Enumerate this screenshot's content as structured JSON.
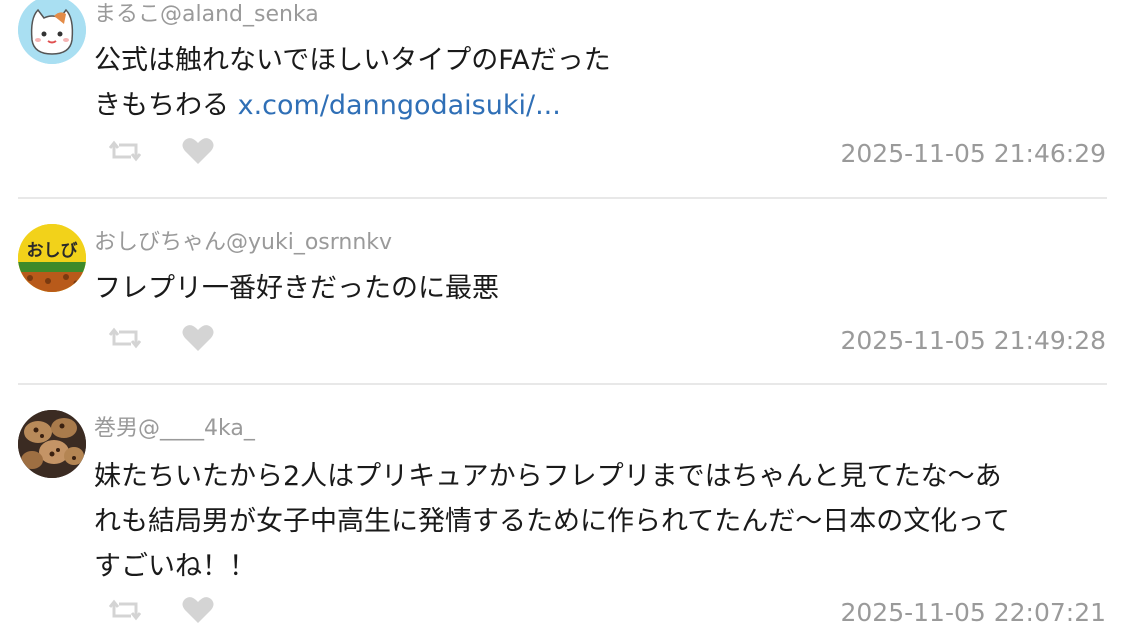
{
  "posts": [
    {
      "display_name": "まるこ",
      "handle": "@aland_senka",
      "text_line1": "公式は触れないでほしいタイプのFAだった",
      "text_line2": "きもちわる ",
      "link": "x.com/danngodaisuki/...",
      "timestamp": "2025-11-05 21:46:29",
      "avatar_icon": "cat-avatar-icon"
    },
    {
      "display_name": "おしびちゃん",
      "handle": "@yuki_osrnnkv",
      "text": "フレプリ一番好きだったのに最悪",
      "timestamp": "2025-11-05 21:49:28",
      "avatar_icon": "curry-avatar-icon",
      "avatar_text": "おしび"
    },
    {
      "display_name": "巻男",
      "handle": "@____4ka_",
      "text_line1": "妹たちいたから2人はプリキュアからフレプリまではちゃんと見てたな〜あ",
      "text_line2": "れも結局男が女子中高生に発情するために作られてたんだ〜日本の文化って",
      "text_line3": "すごいね！！",
      "timestamp": "2025-11-05 22:07:21",
      "avatar_icon": "cookies-avatar-icon"
    }
  ],
  "icons": {
    "retweet": "retweet-icon",
    "like": "heart-icon"
  },
  "colors": {
    "link": "#2f6fb6",
    "meta_text": "#9a9a9a",
    "icon_gray": "#d4d4d4",
    "divider": "#e8e8e8"
  }
}
